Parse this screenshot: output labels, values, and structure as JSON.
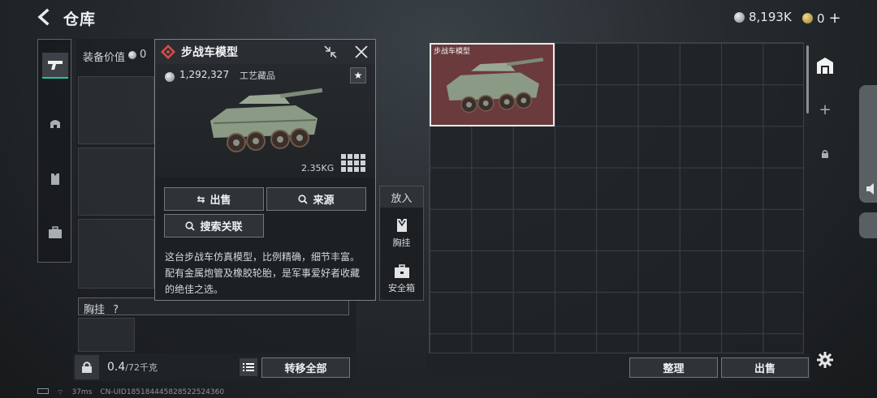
{
  "header": {
    "title": "仓库",
    "currency_amount": "8,193K",
    "premium_amount": "0",
    "premium_add": "+"
  },
  "equipment": {
    "value_label": "装备价值",
    "value": "0",
    "chest_label": "胸挂",
    "chest_help": "?",
    "weight_current": "0.4",
    "weight_max": "/72千克",
    "transfer_all_label": "转移全部"
  },
  "item_popup": {
    "title": "步战车模型",
    "price": "1,292,327",
    "category": "工艺藏品",
    "weight": "2.35KG",
    "sell_label": "出售",
    "source_label": "来源",
    "search_label": "搜索关联",
    "description": "这台步战车仿真模型，比例精确，细节丰富。配有金属炮管及橡胶轮胎，是军事爱好者收藏的绝佳之选。"
  },
  "put_into": {
    "label": "放入",
    "options": [
      "胸挂",
      "安全箱"
    ]
  },
  "storage": {
    "item_label": "步战车模型",
    "arrange_label": "整理",
    "sell_label": "出售"
  },
  "footer": {
    "ping": "37ms",
    "uid": "CN-UID18518444582852252436​0"
  },
  "colors": {
    "accent": "#1ec8a0",
    "item_bg": "#6b3a3d",
    "rarity_red": "#d94a4a"
  }
}
